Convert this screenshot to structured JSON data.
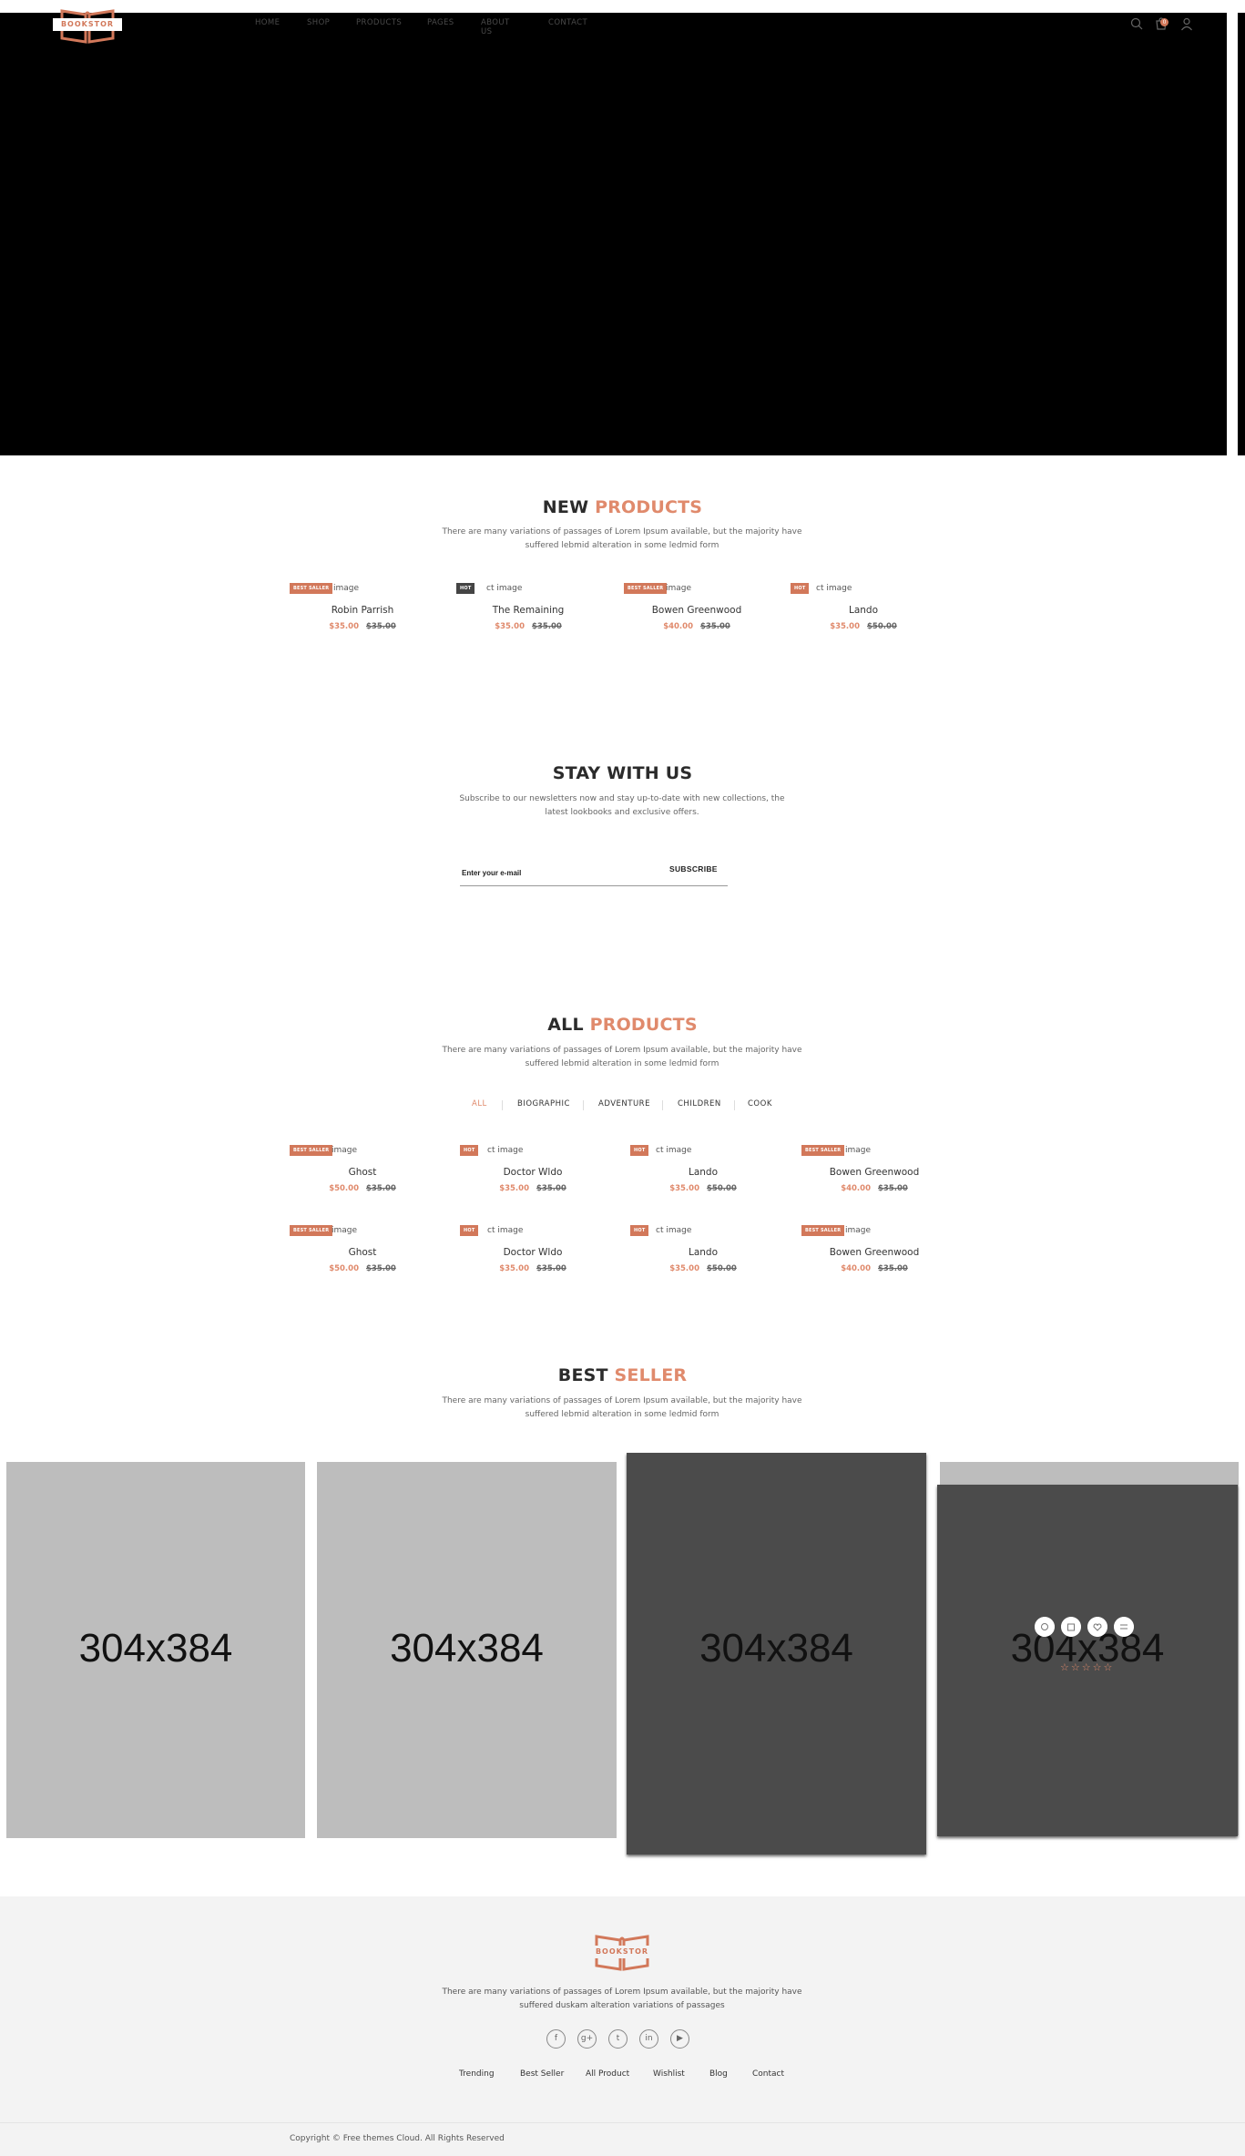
{
  "header": {
    "logo_text": "BOOKSTOR",
    "nav": [
      "HOME",
      "SHOP",
      "PRODUCTS",
      "PAGES",
      "ABOUT US",
      "CONTACT"
    ],
    "cart_count": "0"
  },
  "new_products": {
    "title_a": "NEW",
    "title_b": "PRODUCTS",
    "desc_1": "There are many variations of passages of Lorem Ipsum available, but the majority have",
    "desc_2": "suffered lebmid alteration in some ledmid form",
    "items": [
      {
        "badge": "BEST SALLER",
        "alt": "image",
        "name": "Robin Parrish",
        "price": "$35.00",
        "old": "$35.00"
      },
      {
        "badge": "HOT",
        "alt": "ct image",
        "name": "The Remaining",
        "price": "$35.00",
        "old": "$35.00"
      },
      {
        "badge": "BEST SALLER",
        "alt": "image",
        "name": "Bowen Greenwood",
        "price": "$40.00",
        "old": "$35.00"
      },
      {
        "badge": "HOT",
        "alt": "ct image",
        "name": "Lando",
        "price": "$35.00",
        "old": "$50.00"
      }
    ]
  },
  "newsletter": {
    "title": "STAY WITH US",
    "desc_1": "Subscribe to our newsletters now and stay up-to-date with new collections, the",
    "desc_2": "latest lookbooks and exclusive offers.",
    "placeholder": "Enter your e-mail",
    "button": "SUBSCRIBE"
  },
  "all_products": {
    "title_a": "ALL",
    "title_b": "PRODUCTS",
    "desc_1": "There are many variations of passages of Lorem Ipsum available, but the majority have",
    "desc_2": "suffered lebmid alteration in some ledmid form",
    "filters": [
      "ALL",
      "BIOGRAPHIC",
      "ADVENTURE",
      "CHILDREN",
      "COOK"
    ],
    "rows": [
      [
        {
          "badge": "BEST SALLER",
          "alt": "image",
          "name": "Ghost",
          "price": "$50.00",
          "old": "$35.00"
        },
        {
          "badge": "HOT",
          "alt": "ct image",
          "name": "Doctor Wldo",
          "price": "$35.00",
          "old": "$35.00"
        },
        {
          "badge": "HOT",
          "alt": "ct image",
          "name": "Lando",
          "price": "$35.00",
          "old": "$50.00"
        },
        {
          "badge": "BEST SALLER",
          "alt": "image",
          "name": "Bowen Greenwood",
          "price": "$40.00",
          "old": "$35.00"
        }
      ],
      [
        {
          "badge": "BEST SALLER",
          "alt": "image",
          "name": "Ghost",
          "price": "$50.00",
          "old": "$35.00"
        },
        {
          "badge": "HOT",
          "alt": "ct image",
          "name": "Doctor Wldo",
          "price": "$35.00",
          "old": "$35.00"
        },
        {
          "badge": "HOT",
          "alt": "ct image",
          "name": "Lando",
          "price": "$35.00",
          "old": "$50.00"
        },
        {
          "badge": "BEST SALLER",
          "alt": "image",
          "name": "Bowen Greenwood",
          "price": "$40.00",
          "old": "$35.00"
        }
      ]
    ]
  },
  "best_seller": {
    "title_a": "BEST",
    "title_b": "SELLER",
    "desc_1": "There are many variations of passages of Lorem Ipsum available, but the majority have",
    "desc_2": "suffered lebmid alteration in some ledmid form",
    "placeholder_label": "304x384",
    "rating": "☆☆☆☆☆"
  },
  "footer": {
    "logo_text": "BOOKSTOR",
    "desc_1": "There are many variations of passages of Lorem Ipsum available, but the majority have",
    "desc_2": "suffered duskam alteration variations of passages",
    "socials": [
      "facebook-icon",
      "google-plus-icon",
      "tumblr-icon",
      "linkedin-icon",
      "youtube-icon"
    ],
    "links": [
      "Trending",
      "Best Seller",
      "All Product",
      "Wishlist",
      "Blog",
      "Contact"
    ],
    "copyright": "Copyright © Free themes Cloud. All Rights Reserved"
  },
  "colors": {
    "accent": "#e08a6c",
    "badge_orange": "#d2785a",
    "badge_dark": "#444444"
  }
}
